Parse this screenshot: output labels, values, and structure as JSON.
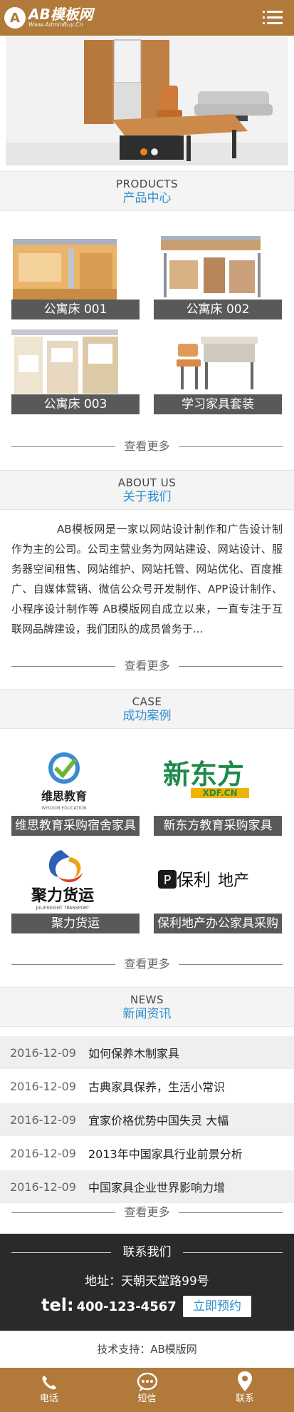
{
  "header": {
    "logo_mark": "A",
    "logo_title": "AB模板网",
    "logo_sub": "Www.AdminBuy.Cn",
    "menu_icon": "menu-icon"
  },
  "banner": {
    "slide_count": 2,
    "active_slide": 1
  },
  "products": {
    "title_en": "PRODUCTS",
    "title_cn": "产品中心",
    "items": [
      {
        "label": "公寓床 001"
      },
      {
        "label": "公寓床 002"
      },
      {
        "label": "公寓床 003"
      },
      {
        "label": "学习家具套装"
      }
    ],
    "more": "查看更多"
  },
  "about": {
    "title_en": "ABOUT US",
    "title_cn": "关于我们",
    "text": "AB模板网是一家以网站设计制作和广告设计制作为主的公司。公司主营业务为网站建设、网站设计、服务器空间租售、网站维护、网站托管、网站优化、百度推广、自媒体营销、微信公众号开发制作、APP设计制作、小程序设计制作等 AB模版网自成立以来，一直专注于互联网品牌建设，我们团队的成员曾务于...",
    "more": "查看更多"
  },
  "cases": {
    "title_en": "CASE",
    "title_cn": "成功案例",
    "items": [
      {
        "label": "维思教育采购宿舍家具",
        "logo_text": "维思教育",
        "logo_sub": "WISDOM EDUCATION"
      },
      {
        "label": "新东方教育采购家具",
        "logo_text": "新东方",
        "logo_sub": "XDF.CN"
      },
      {
        "label": "聚力货运",
        "logo_text": "聚力货运",
        "logo_sub": "JULIFREIGHT TRANSPORT"
      },
      {
        "label": "保利地产办公家具采购",
        "logo_text": "保利",
        "logo_sub": "地产"
      }
    ],
    "more": "查看更多"
  },
  "news": {
    "title_en": "NEWS",
    "title_cn": "新闻资讯",
    "items": [
      {
        "date": "2016-12-09",
        "title": "如何保养木制家具"
      },
      {
        "date": "2016-12-09",
        "title": "古典家具保养，生活小常识"
      },
      {
        "date": "2016-12-09",
        "title": "宜家价格优势中国失灵 大幅"
      },
      {
        "date": "2016-12-09",
        "title": "2013年中国家具行业前景分析"
      },
      {
        "date": "2016-12-09",
        "title": "中国家具企业世界影响力增"
      }
    ],
    "more": "查看更多"
  },
  "contact": {
    "title": "联系我们",
    "address": "地址：天朝天堂路99号",
    "tel_label": "tel:",
    "tel_number": "400-123-4567",
    "book_button": "立即预约"
  },
  "support": "技术支持：AB模版网",
  "bottombar": [
    {
      "label": "电话",
      "icon": "phone-icon"
    },
    {
      "label": "短信",
      "icon": "message-icon"
    },
    {
      "label": "联系",
      "icon": "location-icon"
    }
  ],
  "colors": {
    "brand": "#b17a3a",
    "accent": "#2f8ecf",
    "caption": "#595959",
    "footer": "#2a2a2a"
  }
}
